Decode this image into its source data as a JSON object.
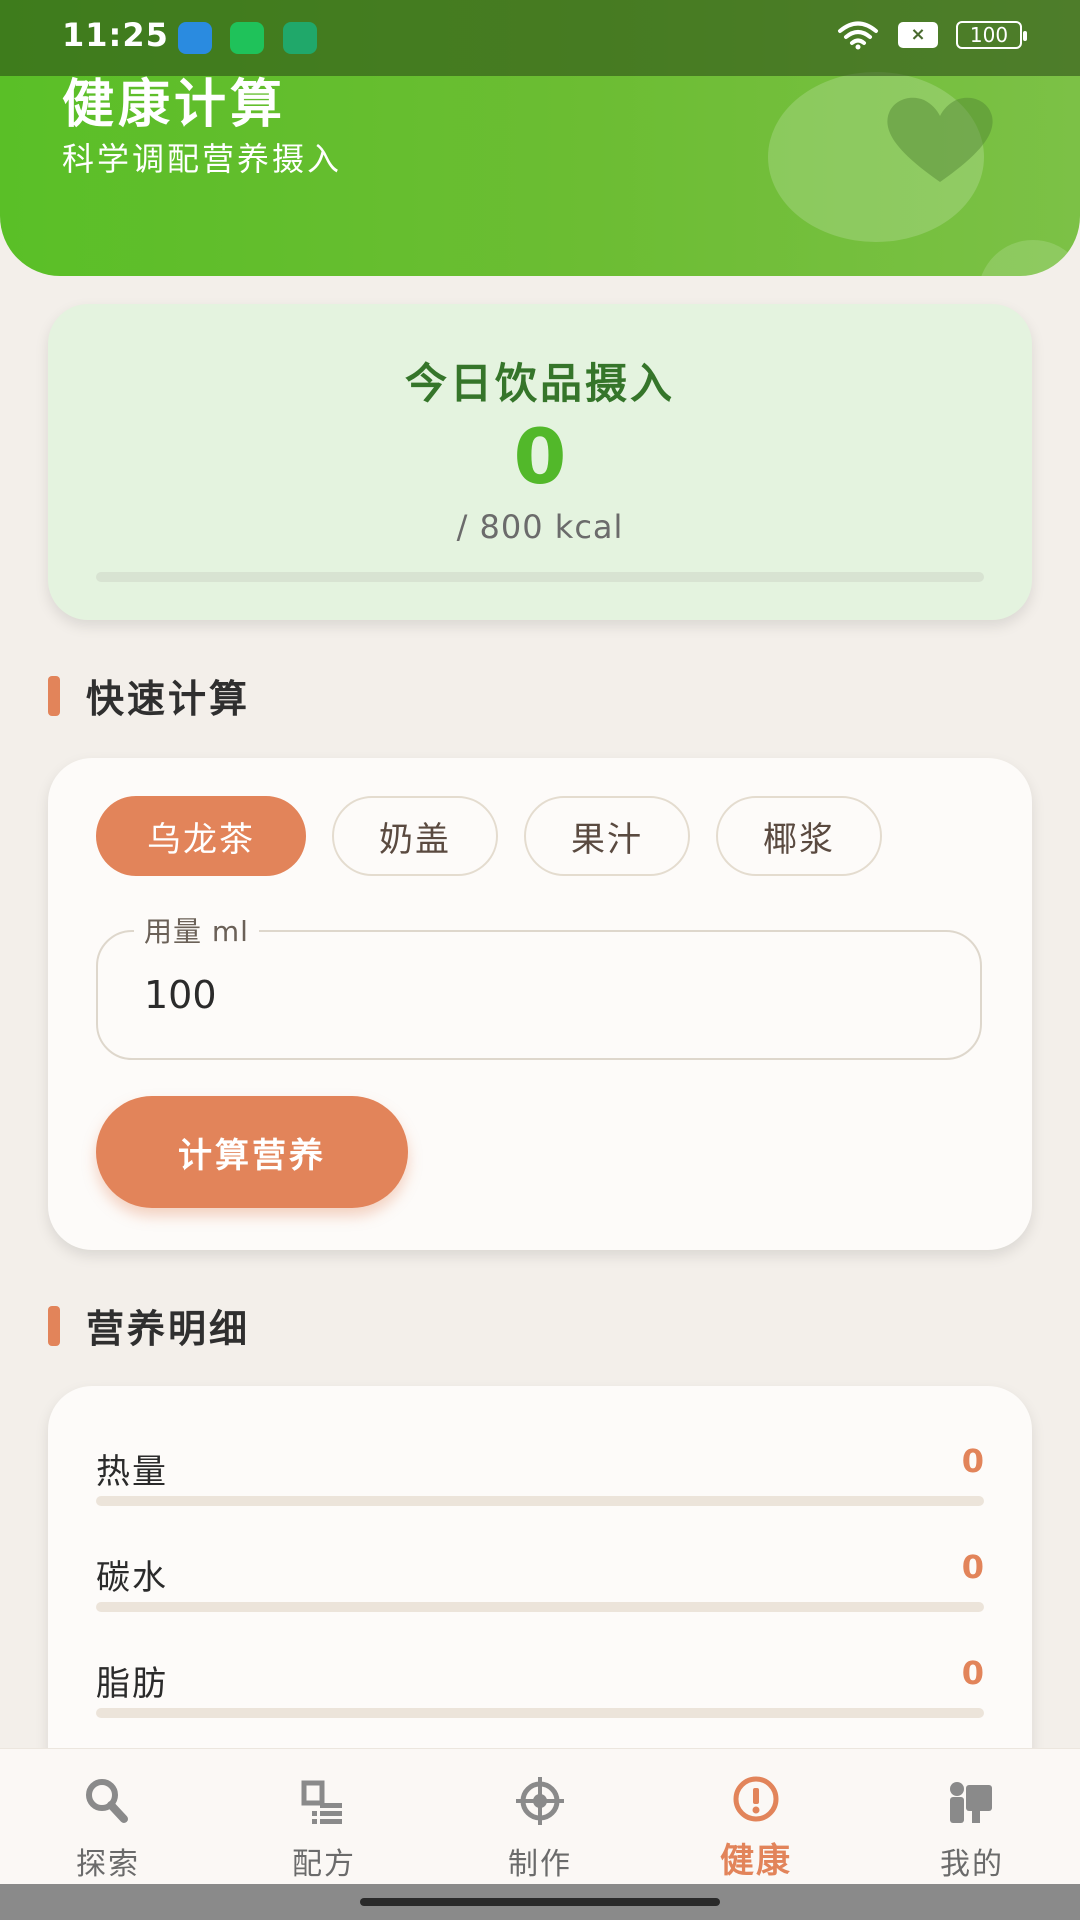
{
  "status": {
    "time": "11:25",
    "battery": "100",
    "sim": "×"
  },
  "header": {
    "title": "健康计算",
    "subtitle": "科学调配营养摄入"
  },
  "intake": {
    "title": "今日饮品摄入",
    "value": "0",
    "goal": "/ 800 kcal",
    "progress": 0
  },
  "quick_calc": {
    "section_title": "快速计算",
    "chips": [
      "乌龙茶",
      "奶盖",
      "果汁",
      "椰浆"
    ],
    "selected_chip": "乌龙茶",
    "amount_label": "用量 ml",
    "amount_value": "100",
    "button_label": "计算营养"
  },
  "nutrition": {
    "section_title": "营养明细",
    "rows": [
      {
        "label": "热量",
        "value": "0",
        "progress": 0
      },
      {
        "label": "碳水",
        "value": "0",
        "progress": 0
      },
      {
        "label": "脂肪",
        "value": "0",
        "progress": 0
      }
    ]
  },
  "nav": {
    "items": [
      "探索",
      "配方",
      "制作",
      "健康",
      "我的"
    ],
    "active": "健康"
  },
  "colors": {
    "accent": "#e2845a",
    "green": "#52b82a",
    "header_green": "#6cbd33"
  }
}
